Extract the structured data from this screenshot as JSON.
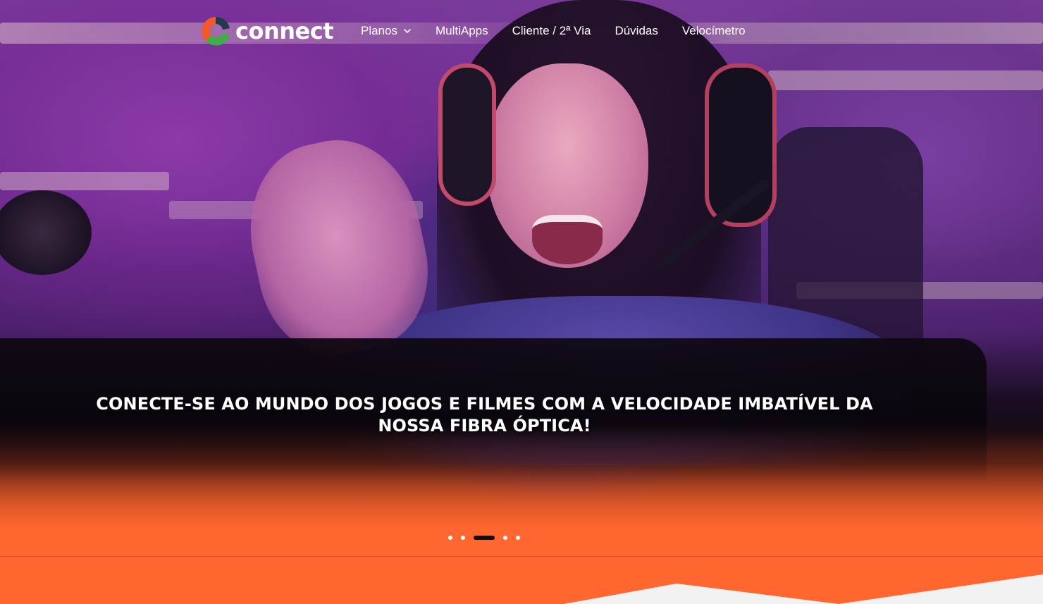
{
  "brand": {
    "name": "connect",
    "colors": {
      "primary_orange": "#ff6630",
      "logo_orange": "#f05a28",
      "logo_green": "#3fae49",
      "logo_dark": "#1f3b4d"
    }
  },
  "nav": {
    "items": [
      {
        "label": "Planos",
        "has_dropdown": true,
        "icon": "chevron-down-icon"
      },
      {
        "label": "MultiApps"
      },
      {
        "label": "Cliente / 2ª Via"
      },
      {
        "label": "Dúvidas"
      },
      {
        "label": "Velocímetro"
      }
    ]
  },
  "hero": {
    "headline": "CONECTE-SE AO MUNDO DOS JOGOS E FILMES COM A VELOCIDADE IMBATÍVEL DA NOSSA FIBRA ÓPTICA!",
    "slider": {
      "total": 5,
      "active_index": 2
    }
  }
}
